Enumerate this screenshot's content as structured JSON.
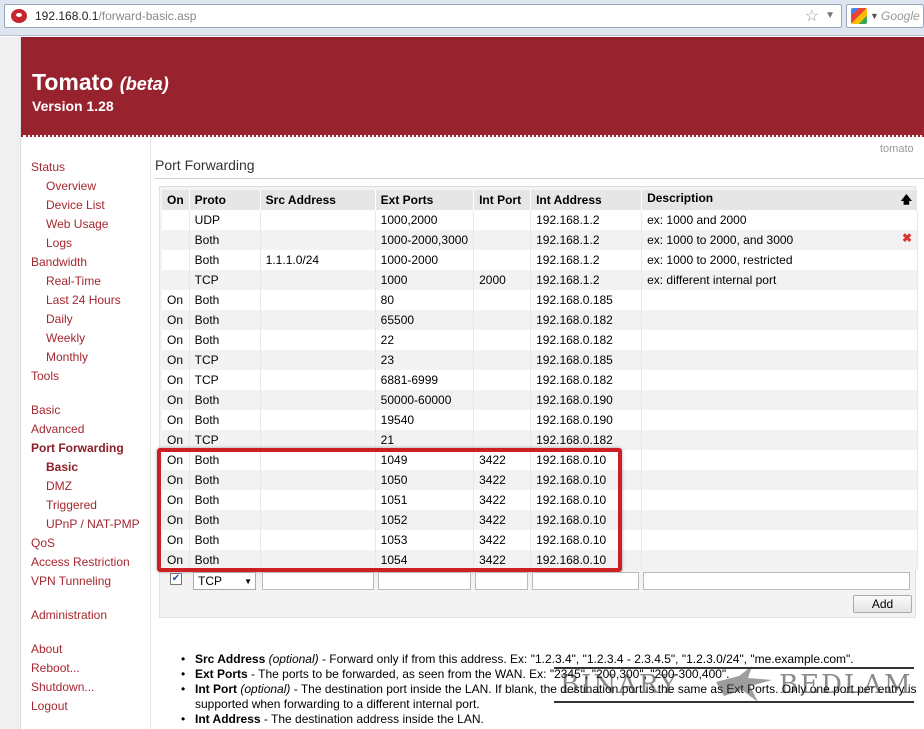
{
  "browser": {
    "url_host": "192.168.0.1",
    "url_path": "/forward-basic.asp",
    "search_placeholder": "Google"
  },
  "header": {
    "title": "Tomato",
    "title_suffix": "(beta)",
    "version": "Version 1.28"
  },
  "hostname": "tomato",
  "nav": {
    "status": "Status",
    "overview": "Overview",
    "device_list": "Device List",
    "web_usage": "Web Usage",
    "logs": "Logs",
    "bandwidth": "Bandwidth",
    "real_time": "Real-Time",
    "last24": "Last 24 Hours",
    "daily": "Daily",
    "weekly": "Weekly",
    "monthly": "Monthly",
    "tools": "Tools",
    "basic": "Basic",
    "advanced": "Advanced",
    "port_forwarding": "Port Forwarding",
    "pf_basic": "Basic",
    "dmz": "DMZ",
    "triggered": "Triggered",
    "upnp": "UPnP / NAT-PMP",
    "qos": "QoS",
    "access_restriction": "Access Restriction",
    "vpn": "VPN Tunneling",
    "administration": "Administration",
    "about": "About",
    "reboot": "Reboot...",
    "shutdown": "Shutdown...",
    "logout": "Logout"
  },
  "section_title": "Port Forwarding",
  "table": {
    "headers": [
      "On",
      "Proto",
      "Src Address",
      "Ext Ports",
      "Int Port",
      "Int Address",
      "Description"
    ],
    "rows": [
      [
        "",
        "UDP",
        "",
        "1000,2000",
        "",
        "192.168.1.2",
        "ex: 1000 and 2000"
      ],
      [
        "",
        "Both",
        "",
        "1000-2000,3000",
        "",
        "192.168.1.2",
        "ex: 1000 to 2000, and 3000"
      ],
      [
        "",
        "Both",
        "1.1.1.0/24",
        "1000-2000",
        "",
        "192.168.1.2",
        "ex: 1000 to 2000, restricted"
      ],
      [
        "",
        "TCP",
        "",
        "1000",
        "2000",
        "192.168.1.2",
        "ex: different internal port"
      ],
      [
        "On",
        "Both",
        "",
        "80",
        "",
        "192.168.0.185",
        ""
      ],
      [
        "On",
        "Both",
        "",
        "65500",
        "",
        "192.168.0.182",
        ""
      ],
      [
        "On",
        "Both",
        "",
        "22",
        "",
        "192.168.0.182",
        ""
      ],
      [
        "On",
        "TCP",
        "",
        "23",
        "",
        "192.168.0.185",
        ""
      ],
      [
        "On",
        "TCP",
        "",
        "6881-6999",
        "",
        "192.168.0.182",
        ""
      ],
      [
        "On",
        "Both",
        "",
        "50000-60000",
        "",
        "192.168.0.190",
        ""
      ],
      [
        "On",
        "Both",
        "",
        "19540",
        "",
        "192.168.0.190",
        ""
      ],
      [
        "On",
        "TCP",
        "",
        "21",
        "",
        "192.168.0.182",
        ""
      ],
      [
        "On",
        "Both",
        "",
        "1049",
        "3422",
        "192.168.0.10",
        ""
      ],
      [
        "On",
        "Both",
        "",
        "1050",
        "3422",
        "192.168.0.10",
        ""
      ],
      [
        "On",
        "Both",
        "",
        "1051",
        "3422",
        "192.168.0.10",
        ""
      ],
      [
        "On",
        "Both",
        "",
        "1052",
        "3422",
        "192.168.0.10",
        ""
      ],
      [
        "On",
        "Both",
        "",
        "1053",
        "3422",
        "192.168.0.10",
        ""
      ],
      [
        "On",
        "Both",
        "",
        "1054",
        "3422",
        "192.168.0.10",
        ""
      ]
    ]
  },
  "new_row": {
    "proto": "TCP",
    "add_label": "Add"
  },
  "notes": [
    {
      "term": "Src Address",
      "qual": "(optional)",
      "text": " - Forward only if from this address. Ex: \"1.2.3.4\", \"1.2.3.4 - 2.3.4.5\", \"1.2.3.0/24\", \"me.example.com\"."
    },
    {
      "term": "Ext Ports",
      "qual": "",
      "text": " - The ports to be forwarded, as seen from the WAN. Ex: \"2345\", \"200,300\", \"200-300,400\"."
    },
    {
      "term": "Int Port",
      "qual": "(optional)",
      "text": " - The destination port inside the LAN. If blank, the destination port is the same as Ext Ports. Only one port per entry is supported when forwarding to a different internal port."
    },
    {
      "term": "Int Address",
      "qual": "",
      "text": " - The destination address inside the LAN."
    }
  ],
  "watermark": {
    "left": "BINARY",
    "right": "BEDLAM"
  },
  "colors": {
    "brand": "#98232e",
    "link": "#a6272f",
    "highlight": "#cc1f26"
  }
}
